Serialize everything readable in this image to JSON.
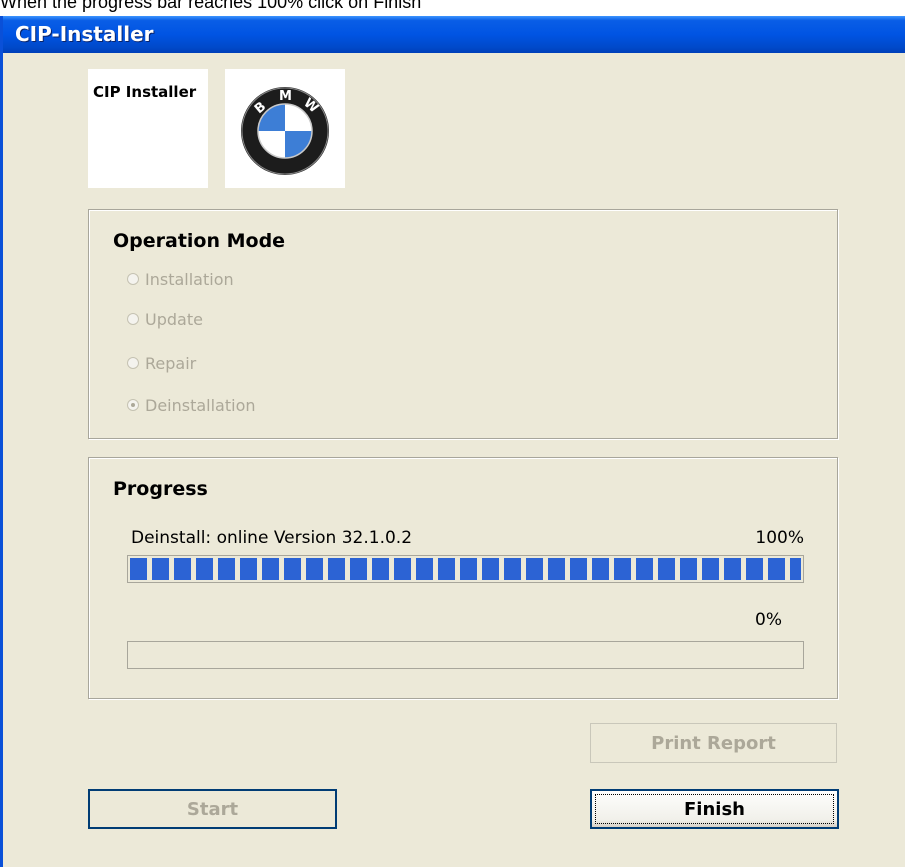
{
  "instruction": "When the progress bar reaches 100% click on Finish",
  "window": {
    "title": "CIP-Installer"
  },
  "logo": {
    "text": "CIP Installer",
    "brand_letters": [
      "B",
      "M",
      "W"
    ]
  },
  "operation_mode": {
    "title": "Operation Mode",
    "options": [
      {
        "label": "Installation",
        "selected": false
      },
      {
        "label": "Update",
        "selected": false
      },
      {
        "label": "Repair",
        "selected": false
      },
      {
        "label": "Deinstallation",
        "selected": true
      }
    ]
  },
  "progress": {
    "title": "Progress",
    "task_label": "Deinstall: online Version 32.1.0.2",
    "task_percent_text": "100%",
    "task_value": 100,
    "overall_percent_text": "0%",
    "overall_value": 0
  },
  "buttons": {
    "print_report": "Print Report",
    "start": "Start",
    "finish": "Finish"
  },
  "colors": {
    "titlebar": "#0054e3",
    "window_bg": "#ece9d8",
    "progress_fill": "#2c63d4",
    "disabled_text": "#aca899"
  }
}
